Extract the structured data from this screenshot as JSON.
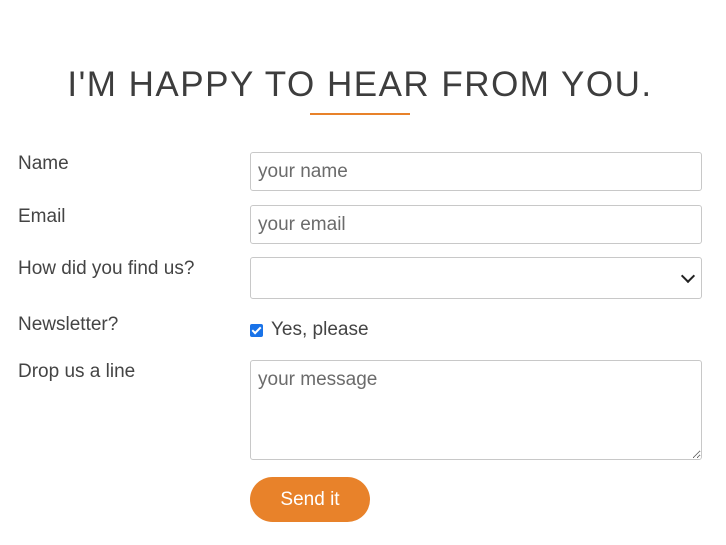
{
  "header": {
    "title": "I'M HAPPY TO HEAR FROM YOU."
  },
  "colors": {
    "accent": "#e8822a",
    "checkbox": "#1a73e8"
  },
  "form": {
    "name": {
      "label": "Name",
      "placeholder": "your name",
      "value": ""
    },
    "email": {
      "label": "Email",
      "placeholder": "your email",
      "value": ""
    },
    "source": {
      "label": "How did you find us?",
      "selected": ""
    },
    "newsletter": {
      "label": "Newsletter?",
      "checkbox_label": "Yes, please",
      "checked": true
    },
    "message": {
      "label": "Drop us a line",
      "placeholder": "your message",
      "value": ""
    },
    "submit_label": "Send it"
  }
}
